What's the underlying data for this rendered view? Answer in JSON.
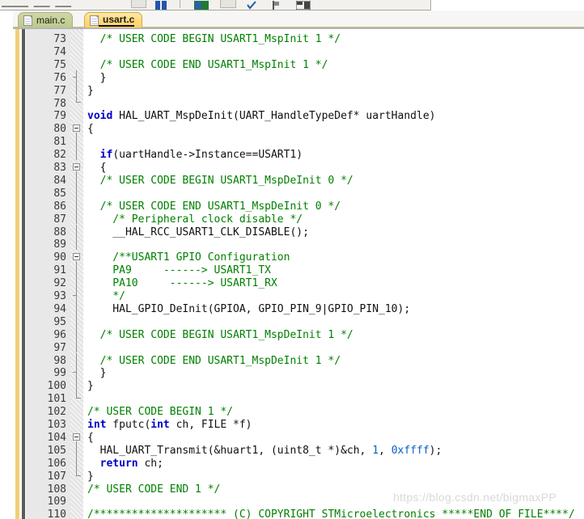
{
  "toolbar": {
    "truncated_label": "_____ ___ ___",
    "icons": [
      "panel-icon",
      "columns-icon",
      "separator",
      "build-icon",
      "window-icon",
      "check-icon",
      "flag-icon",
      "grid-icon"
    ]
  },
  "tabs": [
    {
      "label": "main.c",
      "active": false,
      "icon": "c-file-icon"
    },
    {
      "label": "usart.c",
      "active": true,
      "icon": "c-file-icon"
    }
  ],
  "editor": {
    "first_line": 73,
    "colors": {
      "keyword": "#0000c8",
      "comment": "#008000",
      "number": "#0a5ec6",
      "plain": "#101010",
      "gutter_bg": "#e8e8e8",
      "accent_stripe": "#f2cf72"
    },
    "lines": [
      {
        "n": 73,
        "fold": "",
        "tokens": [
          {
            "t": "cm",
            "s": "  /* USER CODE BEGIN USART1_MspInit 1 */"
          }
        ]
      },
      {
        "n": 74,
        "fold": "",
        "tokens": [
          {
            "t": "pl",
            "s": ""
          }
        ]
      },
      {
        "n": 75,
        "fold": "",
        "tokens": [
          {
            "t": "cm",
            "s": "  /* USER CODE END USART1_MspInit 1 */"
          }
        ]
      },
      {
        "n": 76,
        "fold": "tick",
        "tokens": [
          {
            "t": "pl",
            "s": "  }"
          }
        ]
      },
      {
        "n": 77,
        "fold": "line",
        "tokens": [
          {
            "t": "pl",
            "s": "}"
          }
        ]
      },
      {
        "n": 78,
        "fold": "end",
        "tokens": [
          {
            "t": "pl",
            "s": ""
          }
        ]
      },
      {
        "n": 79,
        "fold": "",
        "tokens": [
          {
            "t": "kw",
            "s": "void"
          },
          {
            "t": "pl",
            "s": " HAL_UART_MspDeInit(UART_HandleTypeDef* uartHandle)"
          }
        ]
      },
      {
        "n": 80,
        "fold": "box",
        "tokens": [
          {
            "t": "pl",
            "s": "{"
          }
        ]
      },
      {
        "n": 81,
        "fold": "line",
        "tokens": [
          {
            "t": "pl",
            "s": ""
          }
        ]
      },
      {
        "n": 82,
        "fold": "line",
        "tokens": [
          {
            "t": "kw",
            "s": "  if"
          },
          {
            "t": "pl",
            "s": "(uartHandle->Instance==USART1)"
          }
        ]
      },
      {
        "n": 83,
        "fold": "box",
        "tokens": [
          {
            "t": "pl",
            "s": "  {"
          }
        ]
      },
      {
        "n": 84,
        "fold": "line",
        "tokens": [
          {
            "t": "cm",
            "s": "  /* USER CODE BEGIN USART1_MspDeInit 0 */"
          }
        ]
      },
      {
        "n": 85,
        "fold": "line",
        "tokens": [
          {
            "t": "pl",
            "s": ""
          }
        ]
      },
      {
        "n": 86,
        "fold": "line",
        "tokens": [
          {
            "t": "cm",
            "s": "  /* USER CODE END USART1_MspDeInit 0 */"
          }
        ]
      },
      {
        "n": 87,
        "fold": "line",
        "tokens": [
          {
            "t": "cm",
            "s": "    /* Peripheral clock disable */"
          }
        ]
      },
      {
        "n": 88,
        "fold": "line",
        "tokens": [
          {
            "t": "pl",
            "s": "    __HAL_RCC_USART1_CLK_DISABLE();"
          }
        ]
      },
      {
        "n": 89,
        "fold": "line",
        "tokens": [
          {
            "t": "pl",
            "s": ""
          }
        ]
      },
      {
        "n": 90,
        "fold": "box",
        "tokens": [
          {
            "t": "cm",
            "s": "    /**USART1 GPIO Configuration"
          }
        ]
      },
      {
        "n": 91,
        "fold": "line",
        "tokens": [
          {
            "t": "cm",
            "s": "    PA9     ------> USART1_TX"
          }
        ]
      },
      {
        "n": 92,
        "fold": "line",
        "tokens": [
          {
            "t": "cm",
            "s": "    PA10     ------> USART1_RX"
          }
        ]
      },
      {
        "n": 93,
        "fold": "tick",
        "tokens": [
          {
            "t": "cm",
            "s": "    */"
          }
        ]
      },
      {
        "n": 94,
        "fold": "line",
        "tokens": [
          {
            "t": "pl",
            "s": "    HAL_GPIO_DeInit(GPIOA, GPIO_PIN_9|GPIO_PIN_10);"
          }
        ]
      },
      {
        "n": 95,
        "fold": "line",
        "tokens": [
          {
            "t": "pl",
            "s": ""
          }
        ]
      },
      {
        "n": 96,
        "fold": "line",
        "tokens": [
          {
            "t": "cm",
            "s": "  /* USER CODE BEGIN USART1_MspDeInit 1 */"
          }
        ]
      },
      {
        "n": 97,
        "fold": "line",
        "tokens": [
          {
            "t": "pl",
            "s": ""
          }
        ]
      },
      {
        "n": 98,
        "fold": "line",
        "tokens": [
          {
            "t": "cm",
            "s": "  /* USER CODE END USART1_MspDeInit 1 */"
          }
        ]
      },
      {
        "n": 99,
        "fold": "tick",
        "tokens": [
          {
            "t": "pl",
            "s": "  }"
          }
        ]
      },
      {
        "n": 100,
        "fold": "line",
        "tokens": [
          {
            "t": "pl",
            "s": "}"
          }
        ]
      },
      {
        "n": 101,
        "fold": "end",
        "tokens": [
          {
            "t": "pl",
            "s": ""
          }
        ]
      },
      {
        "n": 102,
        "fold": "",
        "tokens": [
          {
            "t": "cm",
            "s": "/* USER CODE BEGIN 1 */"
          }
        ]
      },
      {
        "n": 103,
        "fold": "",
        "tokens": [
          {
            "t": "kw",
            "s": "int"
          },
          {
            "t": "pl",
            "s": " fputc("
          },
          {
            "t": "kw",
            "s": "int"
          },
          {
            "t": "pl",
            "s": " ch, FILE *f)"
          }
        ]
      },
      {
        "n": 104,
        "fold": "box",
        "tokens": [
          {
            "t": "pl",
            "s": "{"
          }
        ]
      },
      {
        "n": 105,
        "fold": "line",
        "tokens": [
          {
            "t": "pl",
            "s": "  HAL_UART_Transmit(&huart1, (uint8_t *)&ch, "
          },
          {
            "t": "num",
            "s": "1"
          },
          {
            "t": "pl",
            "s": ", "
          },
          {
            "t": "num",
            "s": "0xffff"
          },
          {
            "t": "pl",
            "s": ");"
          }
        ]
      },
      {
        "n": 106,
        "fold": "line",
        "tokens": [
          {
            "t": "kw",
            "s": "  return"
          },
          {
            "t": "pl",
            "s": " ch;"
          }
        ]
      },
      {
        "n": 107,
        "fold": "end",
        "tokens": [
          {
            "t": "pl",
            "s": "}"
          }
        ]
      },
      {
        "n": 108,
        "fold": "",
        "tokens": [
          {
            "t": "cm",
            "s": "/* USER CODE END 1 */"
          }
        ]
      },
      {
        "n": 109,
        "fold": "",
        "tokens": [
          {
            "t": "pl",
            "s": ""
          }
        ]
      },
      {
        "n": 110,
        "fold": "",
        "tokens": [
          {
            "t": "cm",
            "s": "/********************* (C) COPYRIGHT STMicroelectronics *****END OF FILE****/"
          }
        ]
      }
    ]
  },
  "watermark": {
    "text": "https://blog.csdn.net/bigmaxPP"
  }
}
